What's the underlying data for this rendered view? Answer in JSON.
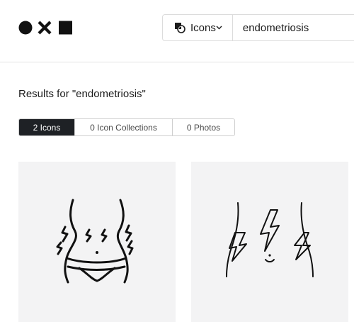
{
  "header": {
    "logo_icons": [
      "circle-icon",
      "x-icon",
      "square-icon"
    ],
    "search": {
      "type_label": "Icons",
      "type_icon": "icons-type-icon",
      "query": "endometriosis"
    }
  },
  "results": {
    "title": "Results for \"endometriosis\"",
    "tabs": [
      {
        "label": "2 Icons",
        "active": true
      },
      {
        "label": "0 Icon Collections",
        "active": false
      },
      {
        "label": "0 Photos",
        "active": false
      }
    ],
    "items": [
      {
        "icon": "endometriosis-pain-waist-icon"
      },
      {
        "icon": "endometriosis-pain-torso-icon"
      }
    ]
  },
  "colors": {
    "active_tab_bg": "#1e2125",
    "tile_bg": "#f3f3f4",
    "divider": "#e2e2e2"
  }
}
